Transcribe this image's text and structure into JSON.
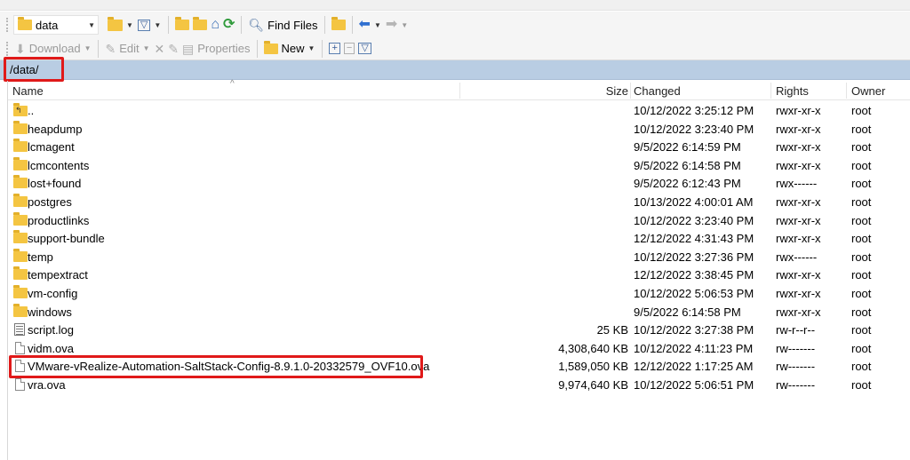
{
  "toolbar1": {
    "location": "data",
    "find_files_label": "Find Files"
  },
  "toolbar2": {
    "download_label": "Download",
    "edit_label": "Edit",
    "properties_label": "Properties",
    "new_label": "New"
  },
  "path": "/data/",
  "columns": {
    "name": "Name",
    "size": "Size",
    "changed": "Changed",
    "rights": "Rights",
    "owner": "Owner"
  },
  "rows": [
    {
      "name": "..",
      "size": "",
      "changed": "10/12/2022 3:25:12 PM",
      "rights": "rwxr-xr-x",
      "owner": "root"
    },
    {
      "name": "heapdump",
      "size": "",
      "changed": "10/12/2022 3:23:40 PM",
      "rights": "rwxr-xr-x",
      "owner": "root"
    },
    {
      "name": "lcmagent",
      "size": "",
      "changed": "9/5/2022 6:14:59 PM",
      "rights": "rwxr-xr-x",
      "owner": "root"
    },
    {
      "name": "lcmcontents",
      "size": "",
      "changed": "9/5/2022 6:14:58 PM",
      "rights": "rwxr-xr-x",
      "owner": "root"
    },
    {
      "name": "lost+found",
      "size": "",
      "changed": "9/5/2022 6:12:43 PM",
      "rights": "rwx------",
      "owner": "root"
    },
    {
      "name": "postgres",
      "size": "",
      "changed": "10/13/2022 4:00:01 AM",
      "rights": "rwxr-xr-x",
      "owner": "root"
    },
    {
      "name": "productlinks",
      "size": "",
      "changed": "10/12/2022 3:23:40 PM",
      "rights": "rwxr-xr-x",
      "owner": "root"
    },
    {
      "name": "support-bundle",
      "size": "",
      "changed": "12/12/2022 4:31:43 PM",
      "rights": "rwxr-xr-x",
      "owner": "root"
    },
    {
      "name": "temp",
      "size": "",
      "changed": "10/12/2022 3:27:36 PM",
      "rights": "rwx------",
      "owner": "root"
    },
    {
      "name": "tempextract",
      "size": "",
      "changed": "12/12/2022 3:38:45 PM",
      "rights": "rwxr-xr-x",
      "owner": "root"
    },
    {
      "name": "vm-config",
      "size": "",
      "changed": "10/12/2022 5:06:53 PM",
      "rights": "rwxr-xr-x",
      "owner": "root"
    },
    {
      "name": "windows",
      "size": "",
      "changed": "9/5/2022 6:14:58 PM",
      "rights": "rwxr-xr-x",
      "owner": "root"
    },
    {
      "name": "script.log",
      "size": "25 KB",
      "changed": "10/12/2022 3:27:38 PM",
      "rights": "rw-r--r--",
      "owner": "root"
    },
    {
      "name": "vidm.ova",
      "size": "4,308,640 KB",
      "changed": "10/12/2022 4:11:23 PM",
      "rights": "rw-------",
      "owner": "root"
    },
    {
      "name": "VMware-vRealize-Automation-SaltStack-Config-8.9.1.0-20332579_OVF10.ova",
      "size": "1,589,050 KB",
      "changed": "12/12/2022 1:17:25 AM",
      "rights": "rw-------",
      "owner": "root"
    },
    {
      "name": "vra.ova",
      "size": "9,974,640 KB",
      "changed": "10/12/2022 5:06:51 PM",
      "rights": "rw-------",
      "owner": "root"
    }
  ],
  "colors": {
    "path_bar": "#b9cde3",
    "highlight_red": "#e01919",
    "folder": "#f4c542"
  }
}
